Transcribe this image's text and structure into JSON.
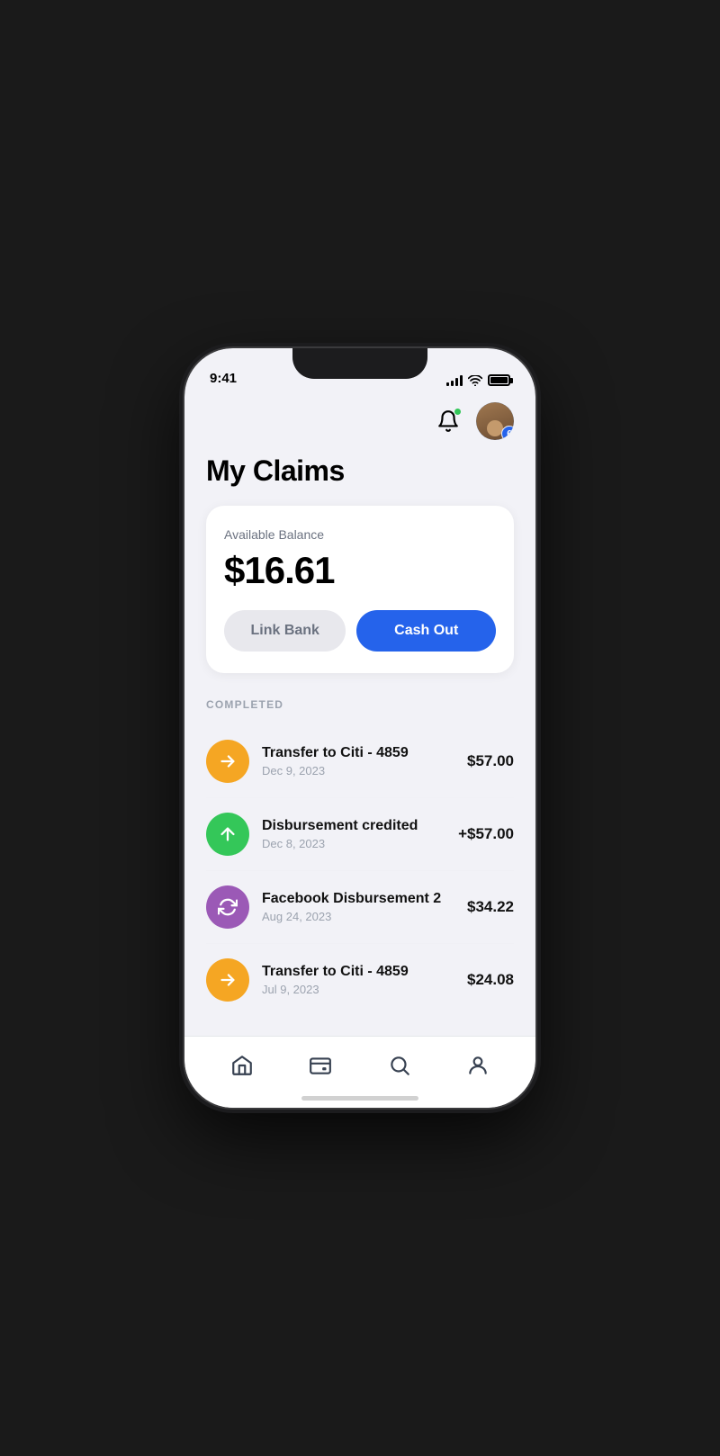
{
  "statusBar": {
    "time": "9:41",
    "batteryLevel": "full"
  },
  "header": {
    "notificationBadgeColor": "#34c759",
    "avatarBadgeCount": "6"
  },
  "pageTitle": "My Claims",
  "balanceCard": {
    "label": "Available Balance",
    "amount": "$16.61",
    "linkBankLabel": "Link Bank",
    "cashOutLabel": "Cash Out"
  },
  "completedSection": {
    "sectionLabel": "COMPLETED",
    "transactions": [
      {
        "id": 1,
        "icon": "arrow-right",
        "iconColor": "yellow",
        "title": "Transfer to Citi - 4859",
        "date": "Dec 9, 2023",
        "amount": "$57.00",
        "positive": false
      },
      {
        "id": 2,
        "icon": "arrow-up",
        "iconColor": "green",
        "title": "Disbursement credited",
        "date": "Dec 8, 2023",
        "amount": "+$57.00",
        "positive": true
      },
      {
        "id": 3,
        "icon": "refresh",
        "iconColor": "purple",
        "title": "Facebook Disbursement 2",
        "date": "Aug 24, 2023",
        "amount": "$34.22",
        "positive": false
      },
      {
        "id": 4,
        "icon": "arrow-right",
        "iconColor": "yellow",
        "title": "Transfer to Citi - 4859",
        "date": "Jul 9, 2023",
        "amount": "$24.08",
        "positive": false
      }
    ]
  },
  "bottomNav": {
    "items": [
      {
        "id": "home",
        "label": "Home",
        "icon": "home",
        "active": true
      },
      {
        "id": "wallet",
        "label": "Wallet",
        "icon": "wallet",
        "active": false
      },
      {
        "id": "search",
        "label": "Search",
        "icon": "search",
        "active": false
      },
      {
        "id": "profile",
        "label": "Profile",
        "icon": "profile",
        "active": false
      }
    ]
  }
}
